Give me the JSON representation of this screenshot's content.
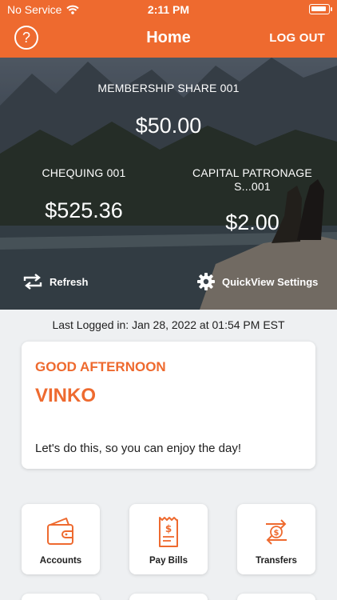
{
  "status_bar": {
    "carrier": "No Service",
    "time": "2:11 PM"
  },
  "nav": {
    "help_symbol": "?",
    "title": "Home",
    "logout_label": "LOG OUT"
  },
  "quickview": {
    "accounts": [
      {
        "label": "MEMBERSHIP SHARE 001",
        "amount": "$50.00"
      },
      {
        "label": "CHEQUING 001",
        "amount": "$525.36"
      },
      {
        "label_line1": "CAPITAL PATRONAGE",
        "label_line2": "S...001",
        "amount": "$2.00"
      }
    ],
    "refresh_label": "Refresh",
    "settings_label": "QuickView Settings"
  },
  "last_logged": "Last Logged in: Jan 28, 2022 at 01:54 PM  EST",
  "greeting": {
    "salutation": "GOOD AFTERNOON",
    "name": "VINKO",
    "message": "Let's do this, so you can enjoy the day!"
  },
  "tiles": [
    {
      "label": "Accounts",
      "icon": "wallet-icon"
    },
    {
      "label": "Pay Bills",
      "icon": "bill-receipt-icon"
    },
    {
      "label": "Transfers",
      "icon": "transfer-icon"
    }
  ],
  "colors": {
    "accent": "#ee6a2f",
    "background": "#eef0f2",
    "card": "#ffffff"
  }
}
